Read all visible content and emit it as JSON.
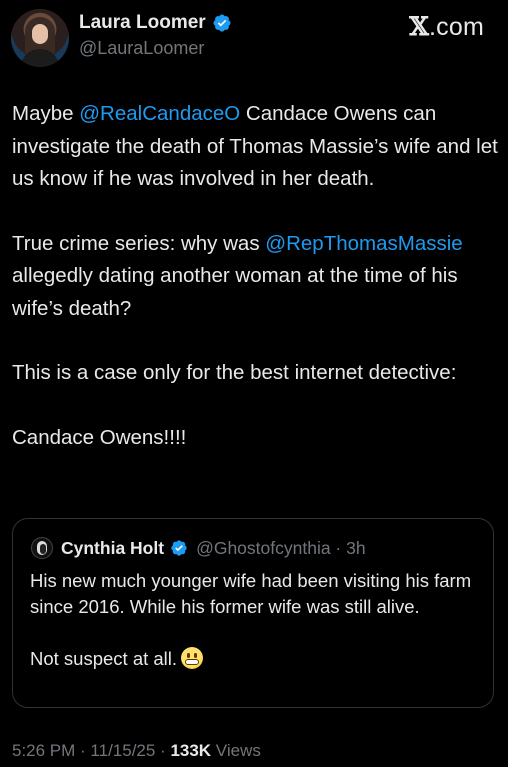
{
  "author": {
    "display_name": "Laura Loomer",
    "handle": "@LauraLoomer"
  },
  "brand": {
    "x": "𝕏",
    "dotcom": ".com"
  },
  "tweet": {
    "p1": {
      "prefix": "Maybe ",
      "mention": "@RealCandaceO",
      "suffix": " Candace Owens can investigate the death of Thomas Massie’s wife and let us know if he was involved in her death."
    },
    "p2": {
      "prefix": "True crime series: why was ",
      "mention": "@RepThomasMassie",
      "suffix": " allegedly dating another woman at the time of his wife’s death?"
    },
    "p3": "This is a case only for the best internet detective:",
    "p4": "Candace Owens!!!!"
  },
  "quote": {
    "name": "Cynthia Holt",
    "handle_time": "@Ghostofcynthia · 3h",
    "p1": "His new much younger wife had been visiting his farm since 2016. While his former wife was still alive.",
    "p2": "Not suspect at all."
  },
  "meta": {
    "time_date": "5:26 PM · 11/15/25 · ",
    "views_count": "133K",
    "views_label": " Views"
  },
  "colors": {
    "background": "#000000",
    "text": "#e7e9ea",
    "secondary": "#71767b",
    "link": "#1d9bf0",
    "verified": "#1d9bf0"
  }
}
